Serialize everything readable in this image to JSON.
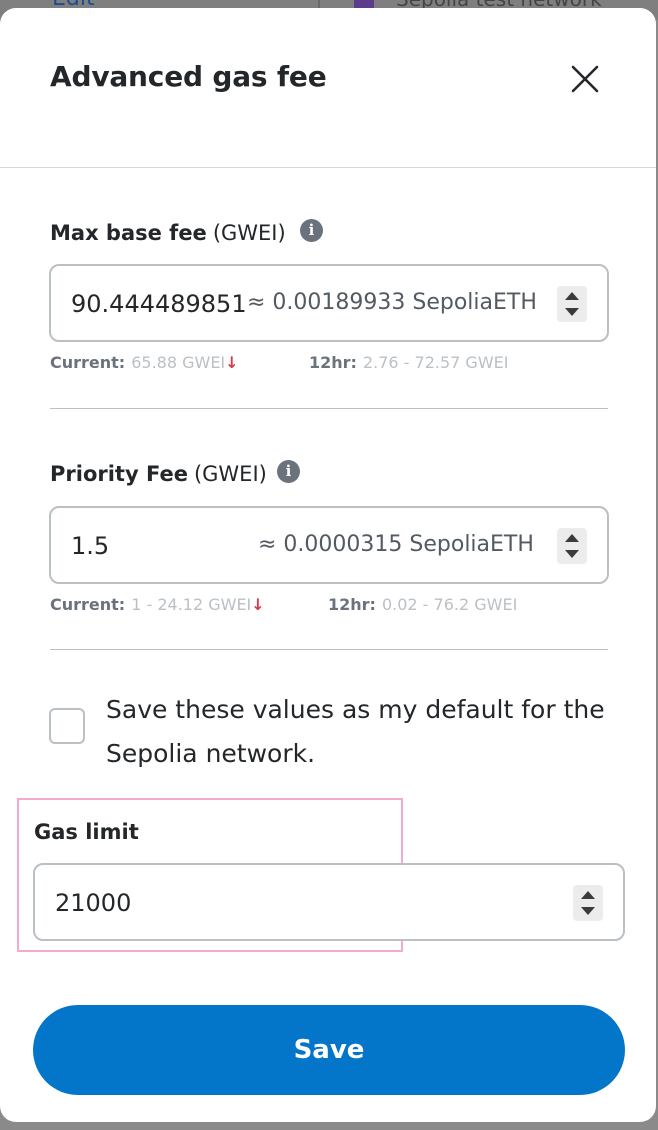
{
  "background": {
    "edit_label": "Edit",
    "network_label": "Sepolia test network"
  },
  "modal": {
    "title": "Advanced gas fee",
    "close_icon": "close-icon"
  },
  "max_base_fee": {
    "label": "Max base fee",
    "unit": "(GWEI)",
    "value": "90.444489851",
    "conversion": "≈ 0.00189933 SepoliaETH",
    "current_label": "Current:",
    "current_value": "65.88 GWEI",
    "trend": "↓",
    "range_label": "12hr:",
    "range_value": "2.76 - 72.57 GWEI"
  },
  "priority_fee": {
    "label": "Priority Fee",
    "unit": "(GWEI)",
    "value": "1.5",
    "conversion": "≈ 0.0000315 SepoliaETH",
    "current_label": "Current:",
    "current_value": "1 - 24.12 GWEI",
    "trend": "↓",
    "range_label": "12hr:",
    "range_value": "0.02 - 76.2 GWEI"
  },
  "save_default": {
    "label": "Save these values as my default for the Sepolia network.",
    "checked": false
  },
  "gas_limit": {
    "label": "Gas limit",
    "value": "21000"
  },
  "save_button": {
    "label": "Save"
  },
  "colors": {
    "primary": "#0376c9",
    "trend_down": "#d73a49",
    "highlight": "#f4a9cd"
  }
}
